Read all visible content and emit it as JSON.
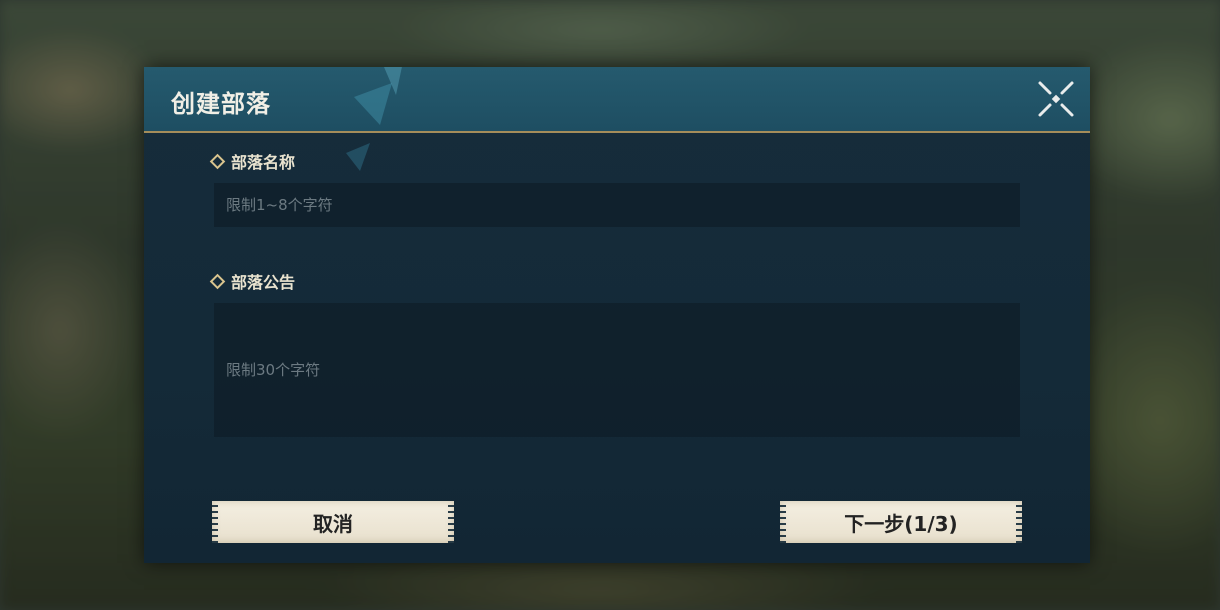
{
  "dialog": {
    "title": "创建部落",
    "close_icon": "close-x-icon"
  },
  "form": {
    "name": {
      "label": "部落名称",
      "placeholder": "限制1~8个字符",
      "value": ""
    },
    "notice": {
      "label": "部落公告",
      "placeholder": "限制30个字符",
      "value": ""
    }
  },
  "buttons": {
    "cancel_label": "取消",
    "next_label": "下一步(1/3)"
  },
  "colors": {
    "header": "#1e4e62",
    "panel": "#142a38",
    "accent_gold": "#a48d5a",
    "button_bg": "#f4efe2"
  }
}
